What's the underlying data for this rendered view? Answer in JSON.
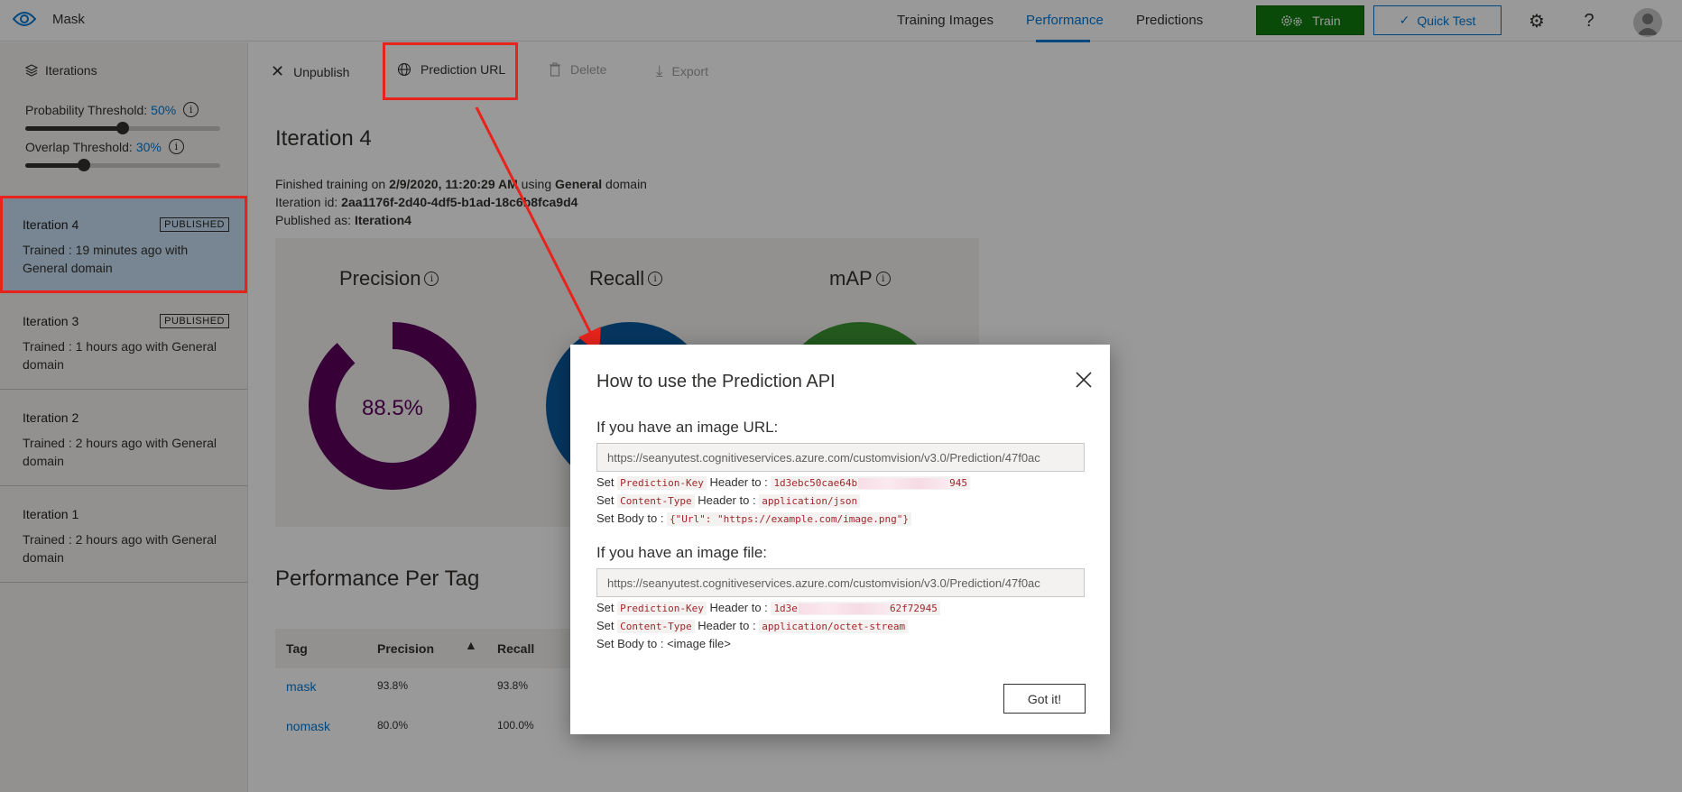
{
  "app": {
    "name": "Mask"
  },
  "nav": {
    "training_images": "Training Images",
    "performance": "Performance",
    "predictions": "Predictions",
    "train": "Train",
    "quick_test": "Quick Test"
  },
  "colors": {
    "accent": "#0078d4",
    "train_green": "#107c10",
    "highlight_red": "#e8231c",
    "precision": "#5c005c",
    "recall": "#0a5aa0",
    "map": "#3c9632"
  },
  "sidebar": {
    "iterations_label": "Iterations",
    "probability_label": "Probability Threshold:",
    "probability_value": "50%",
    "overlap_label": "Overlap Threshold:",
    "overlap_value": "30%",
    "probability_fraction": 0.5,
    "overlap_fraction": 0.3,
    "items": [
      {
        "title": "Iteration 4",
        "badge": "PUBLISHED",
        "sub": "Trained : 19 minutes ago with General domain"
      },
      {
        "title": "Iteration 3",
        "badge": "PUBLISHED",
        "sub": "Trained : 1 hours ago with General domain"
      },
      {
        "title": "Iteration 2",
        "badge": "",
        "sub": "Trained : 2 hours ago with General domain"
      },
      {
        "title": "Iteration 1",
        "badge": "",
        "sub": "Trained : 2 hours ago with General domain"
      }
    ]
  },
  "toolbar": {
    "unpublish": "Unpublish",
    "prediction_url": "Prediction URL",
    "delete": "Delete",
    "export": "Export"
  },
  "main": {
    "title": "Iteration 4",
    "finished_prefix": "Finished training on",
    "finished_date": "2/9/2020, 11:20:29 AM",
    "finished_using": "using",
    "finished_domain": "General",
    "finished_suffix": "domain",
    "iteration_id_label": "Iteration id:",
    "iteration_id": "2aa1176f-2d40-4df5-b1ad-18c6b8fca9d4",
    "published_label": "Published as:",
    "published_name": "Iteration4"
  },
  "metrics": {
    "precision_label": "Precision",
    "recall_label": "Recall",
    "map_label": "mAP",
    "precision_value": "88.5%",
    "precision_fraction": 0.885
  },
  "perf": {
    "title": "Performance Per Tag",
    "headers": [
      "Tag",
      "Precision",
      "Recall"
    ],
    "rows": [
      {
        "tag": "mask",
        "precision": "93.8%",
        "recall": "93.8%"
      },
      {
        "tag": "nomask",
        "precision": "80.0%",
        "recall": "100.0%"
      }
    ]
  },
  "dialog": {
    "title": "How to use the Prediction API",
    "url_heading": "If you have an image URL:",
    "url": "https://seanyutest.cognitiveservices.azure.com/customvision/v3.0/Prediction/47f0ac",
    "file_heading": "If you have an image file:",
    "file_url": "https://seanyutest.cognitiveservices.azure.com/customvision/v3.0/Prediction/47f0ac",
    "set": "Set",
    "header_to": "Header to :",
    "body_to": "Set Body to :",
    "prediction_key": "Prediction-Key",
    "content_type": "Content-Type",
    "key1_start": "1d3ebc50cae64b",
    "key1_end": "945",
    "json_type": "application/json",
    "body_json": "{\"Url\": \"https://example.com/image.png\"}",
    "key2_start": "1d3e",
    "key2_end": "62f72945",
    "octet_type": "application/octet-stream",
    "body_file": "<image file>",
    "got_it": "Got it!"
  }
}
